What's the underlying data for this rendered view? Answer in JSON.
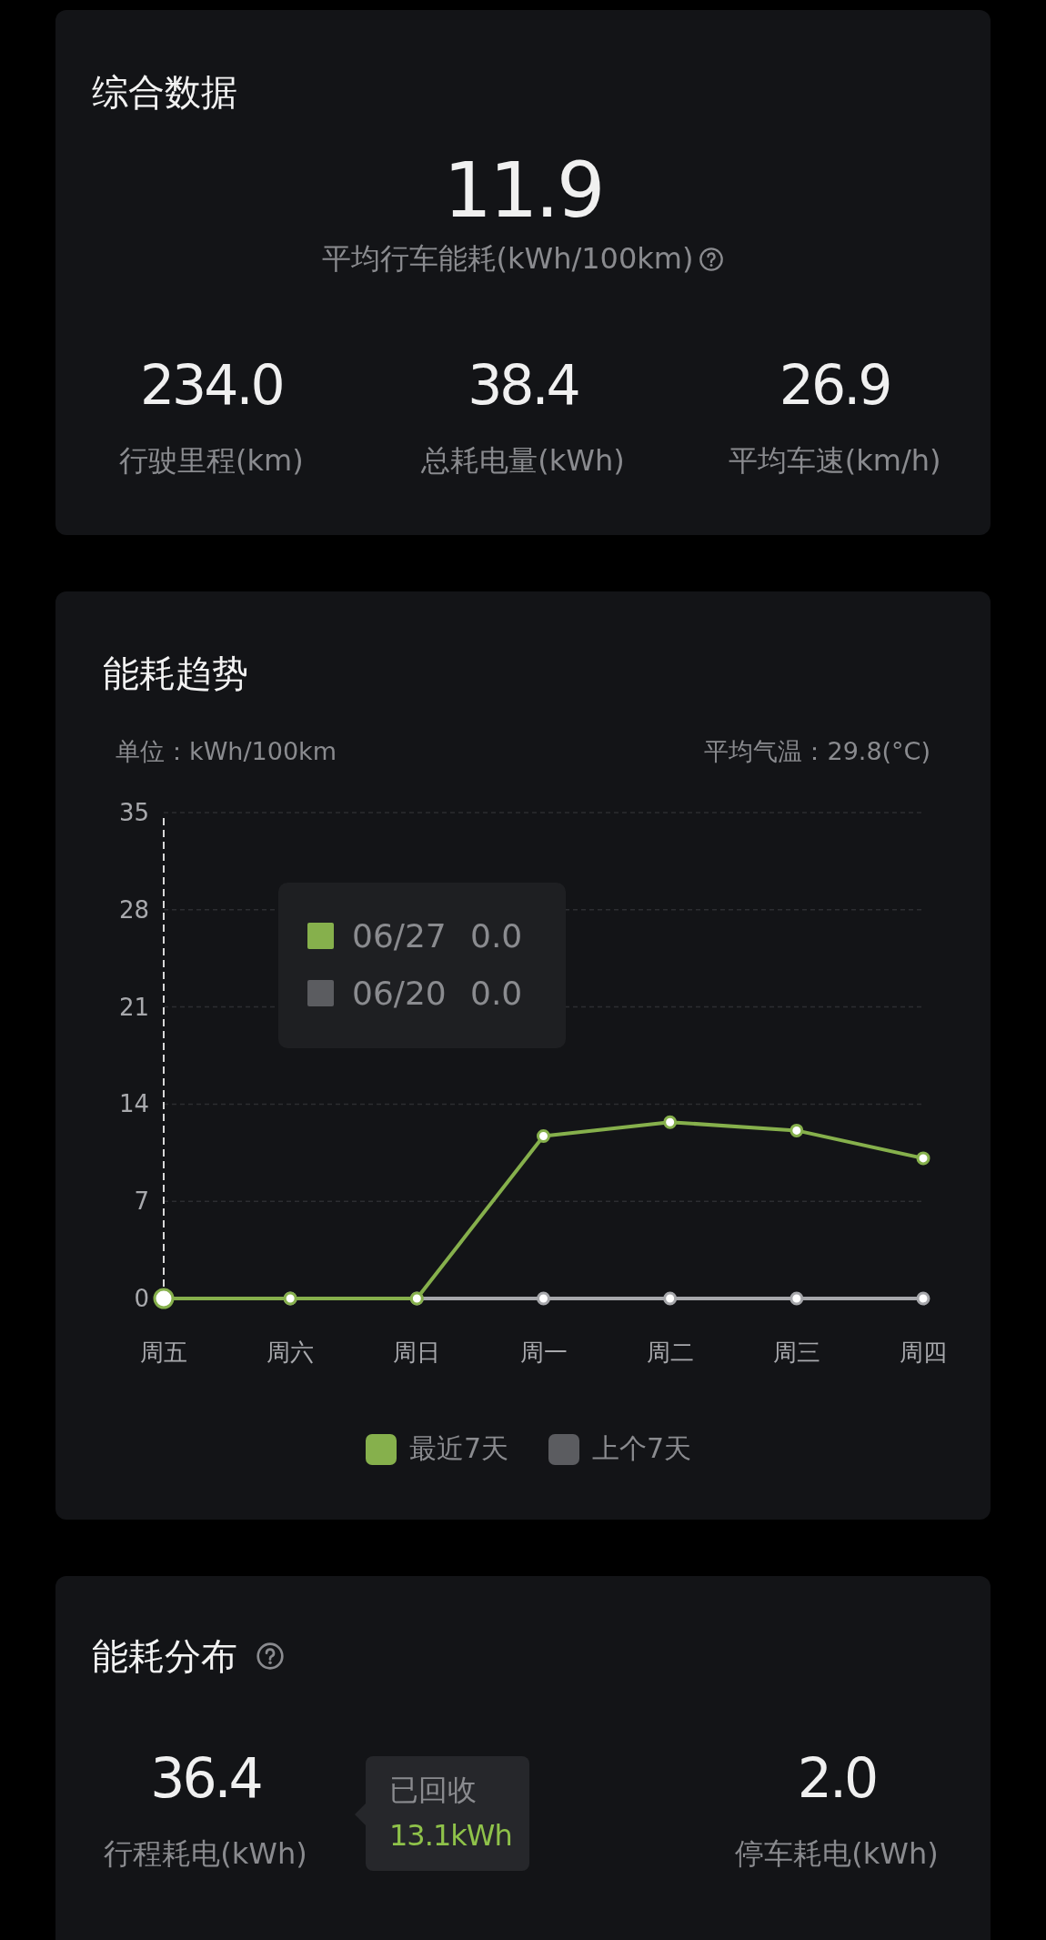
{
  "summary": {
    "title": "综合数据",
    "main": {
      "value": "11.9",
      "label": "平均行车能耗(kWh/100km)"
    },
    "stats": [
      {
        "value": "234.0",
        "label": "行驶里程(km)"
      },
      {
        "value": "38.4",
        "label": "总耗电量(kWh)"
      },
      {
        "value": "26.9",
        "label": "平均车速(km/h)"
      }
    ]
  },
  "trend": {
    "title": "能耗趋势",
    "unit": "单位：kWh/100km",
    "temperature": "平均气温：29.8(°C)",
    "chart_data": {
      "type": "line",
      "categories": [
        "周五",
        "周六",
        "周日",
        "周一",
        "周二",
        "周三",
        "周四"
      ],
      "series": [
        {
          "name": "最近7天",
          "color": "#86b04c",
          "marker": "circle",
          "values": [
            0,
            0,
            0,
            11.7,
            12.7,
            12.1,
            10.1
          ]
        },
        {
          "name": "上个7天",
          "color": "#a6a7ab",
          "marker": "circle",
          "values": [
            0,
            0,
            0,
            0,
            0,
            0,
            0
          ]
        }
      ],
      "ylim": [
        0,
        35
      ],
      "yticks": [
        0,
        7,
        14,
        21,
        28,
        35
      ],
      "grid": true
    },
    "legend": [
      {
        "color": "#86b04c"
      },
      {
        "color": "#5b5c60"
      }
    ],
    "tooltip": [
      {
        "date": "06/27",
        "value": "0.0",
        "color": "#86b04c"
      },
      {
        "date": "06/20",
        "value": "0.0",
        "color": "#5b5c60"
      }
    ]
  },
  "distribution": {
    "title": "能耗分布",
    "stats": [
      {
        "value": "36.4",
        "label": "行程耗电(kWh)"
      },
      {
        "value": "2.0",
        "label": "停车耗电(kWh)"
      }
    ],
    "callout": {
      "label": "已回收",
      "value": "13.1kWh"
    }
  }
}
